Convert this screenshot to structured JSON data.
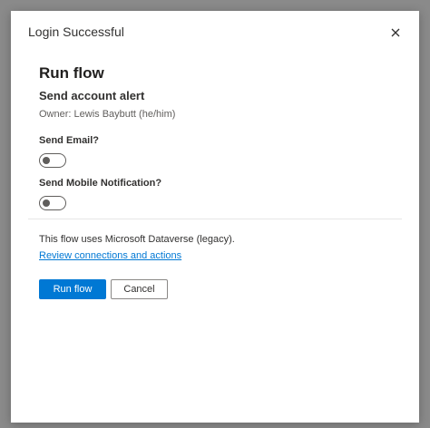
{
  "window": {
    "title": "Login Successful"
  },
  "panel": {
    "title": "Run flow",
    "flow_name": "Send account alert",
    "owner": "Owner: Lewis Baybutt (he/him)"
  },
  "fields": [
    {
      "label": "Send Email?",
      "checked": false
    },
    {
      "label": "Send Mobile Notification?",
      "checked": false
    }
  ],
  "info": {
    "text": "This flow uses Microsoft Dataverse (legacy).",
    "link": "Review connections and actions"
  },
  "buttons": {
    "primary": "Run flow",
    "secondary": "Cancel"
  },
  "colors": {
    "primary": "#0078d4",
    "link": "#0078d4",
    "backdrop": "#8a8a8a"
  },
  "icons": {
    "close": "close-icon"
  }
}
